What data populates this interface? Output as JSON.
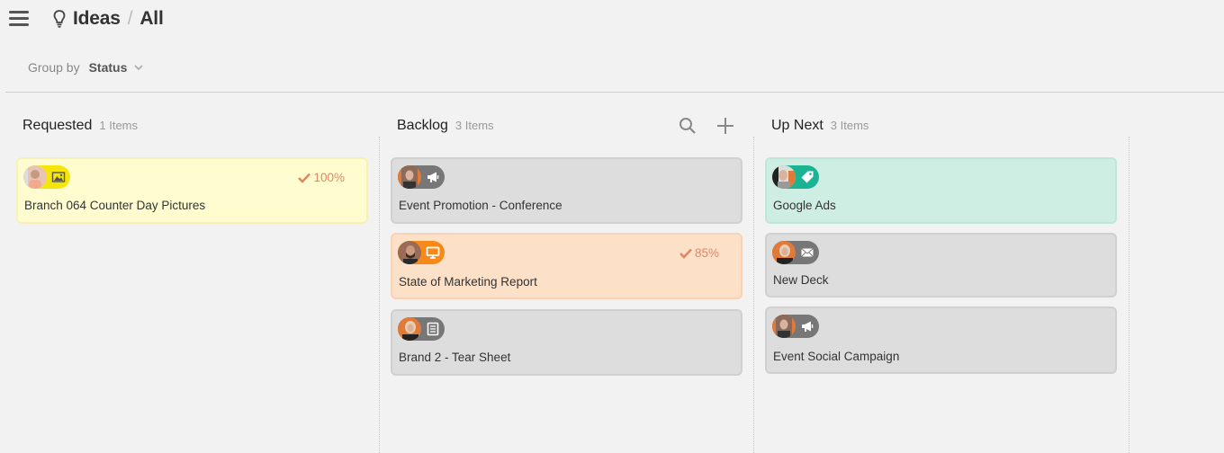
{
  "header": {
    "menu_icon": "hamburger-icon",
    "section_icon": "lightbulb-icon",
    "breadcrumb": [
      "Ideas",
      "All"
    ],
    "separator": "/"
  },
  "toolbar": {
    "group_by_label": "Group by",
    "group_by_value": "Status"
  },
  "columns": [
    {
      "title": "Requested",
      "count": "1 Items",
      "cards": [
        {
          "title": "Branch 064 Counter Day Pictures",
          "color": "#fffdd0",
          "type_icon": "image-icon",
          "progress": "100%"
        }
      ]
    },
    {
      "title": "Backlog",
      "count": "3 Items",
      "tools": [
        "search-icon",
        "plus-icon"
      ],
      "cards": [
        {
          "title": "Event Promotion - Conference",
          "color": "#dddddd",
          "type_icon": "megaphone-icon"
        },
        {
          "title": "State of Marketing Report",
          "color": "#fde0c8",
          "type_icon": "monitor-icon",
          "progress": "85%"
        },
        {
          "title": "Brand 2 - Tear Sheet",
          "color": "#dddddd",
          "type_icon": "document-icon"
        }
      ]
    },
    {
      "title": "Up Next",
      "count": "3 Items",
      "cards": [
        {
          "title": "Google Ads",
          "color": "#ceeee4",
          "type_icon": "tag-icon"
        },
        {
          "title": "New Deck",
          "color": "#dddddd",
          "type_icon": "envelope-icon"
        },
        {
          "title": "Event Social Campaign",
          "color": "#dddddd",
          "type_icon": "megaphone-icon"
        }
      ]
    }
  ],
  "colors": {
    "progress": "#e08866",
    "yellow_pill": "#f6e50a",
    "orange_pill": "#f7891a",
    "teal_pill": "#1bb394",
    "gray_pill": "#777777"
  }
}
